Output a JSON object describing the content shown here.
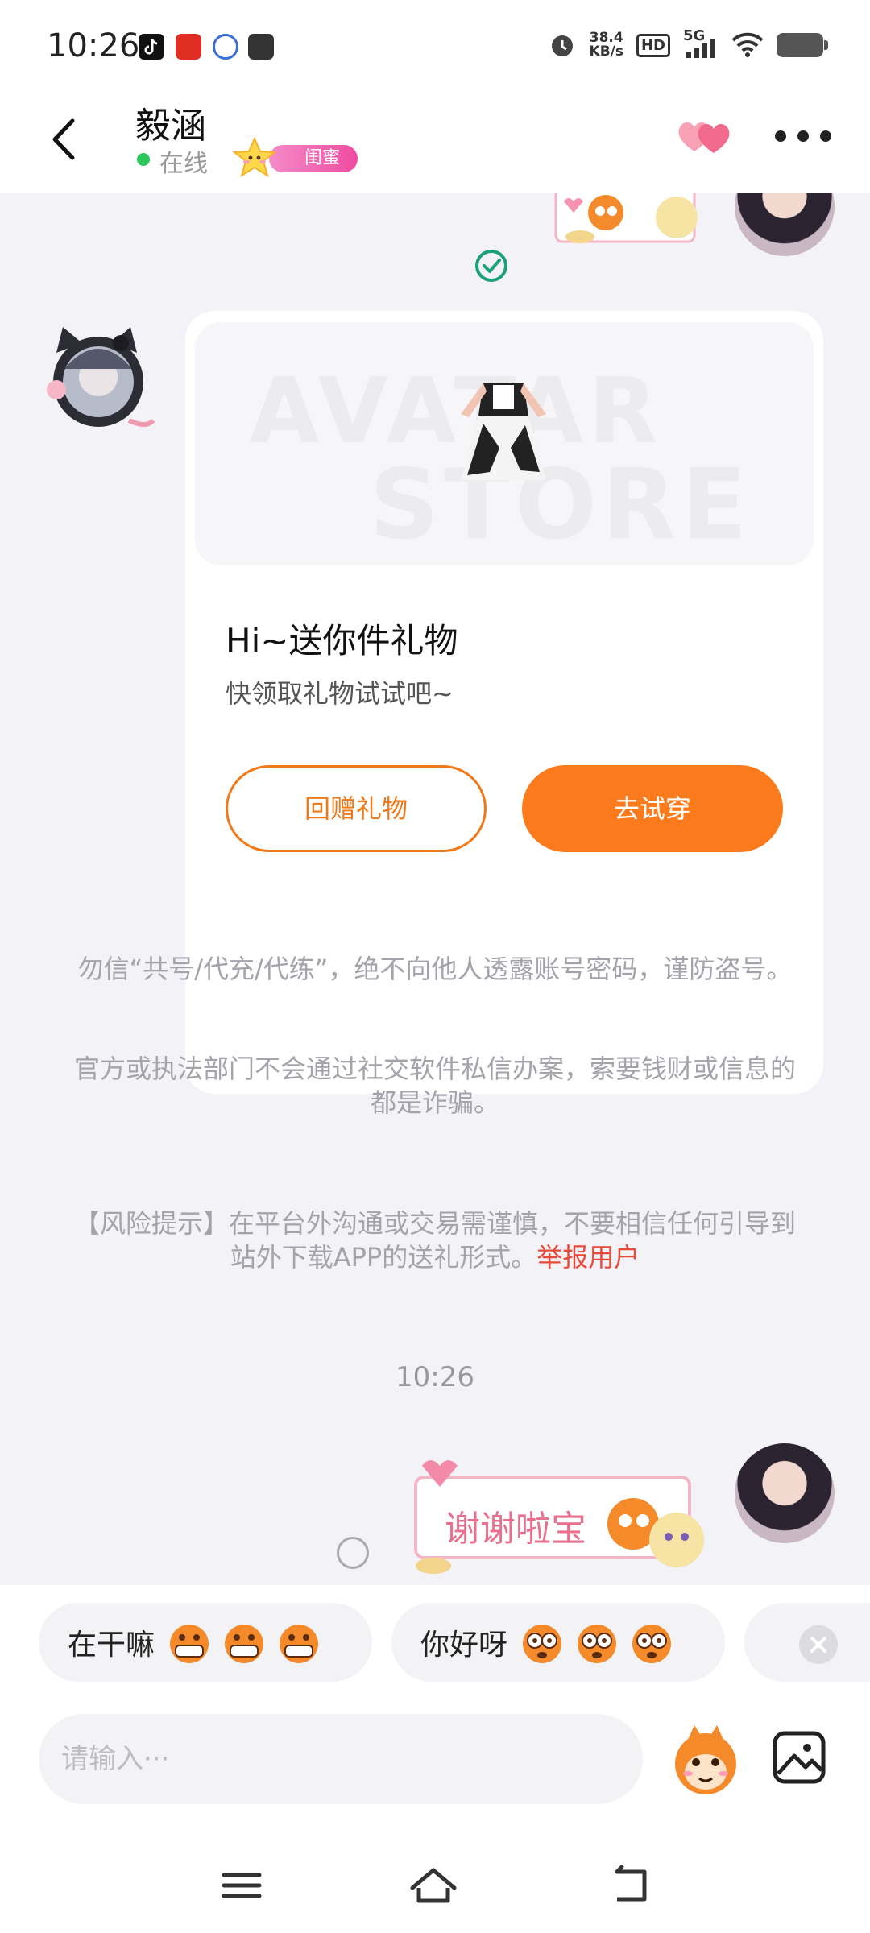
{
  "status_bar": {
    "time": "10:26",
    "network_speed_value": "38.4",
    "network_speed_unit": "KB/s",
    "hd_label": "HD",
    "signal_label": "5G",
    "app_icons": [
      "douyin-icon",
      "pinduoduo-icon",
      "jlcy-icon",
      "bag-icon"
    ]
  },
  "header": {
    "name": "毅涵",
    "status": "在线",
    "badge": "闺蜜"
  },
  "gift_card": {
    "title": "Hi~送你件礼物",
    "subtitle": "快领取礼物试试吧~",
    "return_button": "回赠礼物",
    "try_button": "去试穿"
  },
  "notices": {
    "line1": "勿信“共号/代充/代练”，绝不向他人透露账号密码，谨防盗号。",
    "line2": "官方或执法部门不会通过社交软件私信办案，索要钱财或信息的都是诈骗。",
    "risk": "【风险提示】在平台外沟通或交易需谨慎，不要相信任何引导到站外下载APP的送礼形式。",
    "report_link": "举报用户"
  },
  "timestamp": "10:26",
  "thanks_sticker_text": "谢谢啦宝",
  "quick_replies": [
    {
      "label": "在干嘛"
    },
    {
      "label": "你好呀"
    }
  ],
  "input": {
    "placeholder": "请输入···"
  },
  "colors": {
    "accent_orange": "#fb7a1b",
    "report_red": "#e84a3a",
    "online_green": "#2ac85a",
    "badge_pink": "#ef4ba0"
  }
}
